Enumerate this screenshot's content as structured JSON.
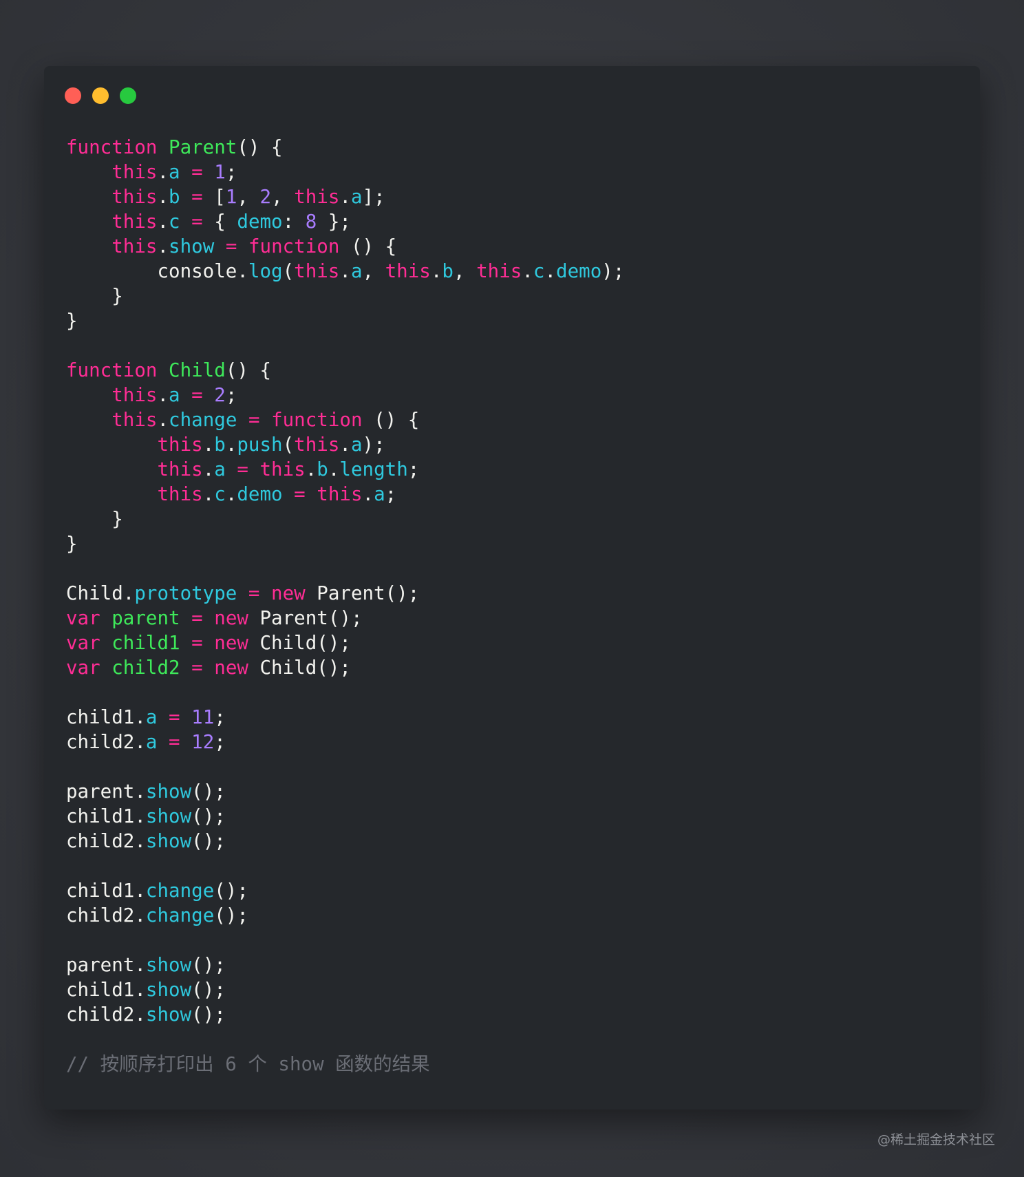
{
  "window": {
    "controls": [
      {
        "name": "close",
        "color": "#ff5f56"
      },
      {
        "name": "minimize",
        "color": "#ffbd2e"
      },
      {
        "name": "maximize",
        "color": "#27c93f"
      }
    ]
  },
  "code": {
    "language": "javascript",
    "lines": [
      [
        {
          "t": "k",
          "v": "function"
        },
        {
          "t": "t",
          "v": " "
        },
        {
          "t": "f",
          "v": "Parent"
        },
        {
          "t": "t",
          "v": "() {"
        }
      ],
      [
        {
          "t": "t",
          "v": "    "
        },
        {
          "t": "k",
          "v": "this"
        },
        {
          "t": "t",
          "v": "."
        },
        {
          "t": "p",
          "v": "a"
        },
        {
          "t": "t",
          "v": " "
        },
        {
          "t": "k",
          "v": "="
        },
        {
          "t": "t",
          "v": " "
        },
        {
          "t": "n",
          "v": "1"
        },
        {
          "t": "t",
          "v": ";"
        }
      ],
      [
        {
          "t": "t",
          "v": "    "
        },
        {
          "t": "k",
          "v": "this"
        },
        {
          "t": "t",
          "v": "."
        },
        {
          "t": "p",
          "v": "b"
        },
        {
          "t": "t",
          "v": " "
        },
        {
          "t": "k",
          "v": "="
        },
        {
          "t": "t",
          "v": " ["
        },
        {
          "t": "n",
          "v": "1"
        },
        {
          "t": "t",
          "v": ", "
        },
        {
          "t": "n",
          "v": "2"
        },
        {
          "t": "t",
          "v": ", "
        },
        {
          "t": "k",
          "v": "this"
        },
        {
          "t": "t",
          "v": "."
        },
        {
          "t": "p",
          "v": "a"
        },
        {
          "t": "t",
          "v": "];"
        }
      ],
      [
        {
          "t": "t",
          "v": "    "
        },
        {
          "t": "k",
          "v": "this"
        },
        {
          "t": "t",
          "v": "."
        },
        {
          "t": "p",
          "v": "c"
        },
        {
          "t": "t",
          "v": " "
        },
        {
          "t": "k",
          "v": "="
        },
        {
          "t": "t",
          "v": " { "
        },
        {
          "t": "p",
          "v": "demo"
        },
        {
          "t": "t",
          "v": ": "
        },
        {
          "t": "n",
          "v": "8"
        },
        {
          "t": "t",
          "v": " };"
        }
      ],
      [
        {
          "t": "t",
          "v": "    "
        },
        {
          "t": "k",
          "v": "this"
        },
        {
          "t": "t",
          "v": "."
        },
        {
          "t": "p",
          "v": "show"
        },
        {
          "t": "t",
          "v": " "
        },
        {
          "t": "k",
          "v": "="
        },
        {
          "t": "t",
          "v": " "
        },
        {
          "t": "k",
          "v": "function"
        },
        {
          "t": "t",
          "v": " () {"
        }
      ],
      [
        {
          "t": "t",
          "v": "        console."
        },
        {
          "t": "p",
          "v": "log"
        },
        {
          "t": "t",
          "v": "("
        },
        {
          "t": "k",
          "v": "this"
        },
        {
          "t": "t",
          "v": "."
        },
        {
          "t": "p",
          "v": "a"
        },
        {
          "t": "t",
          "v": ", "
        },
        {
          "t": "k",
          "v": "this"
        },
        {
          "t": "t",
          "v": "."
        },
        {
          "t": "p",
          "v": "b"
        },
        {
          "t": "t",
          "v": ", "
        },
        {
          "t": "k",
          "v": "this"
        },
        {
          "t": "t",
          "v": "."
        },
        {
          "t": "p",
          "v": "c"
        },
        {
          "t": "t",
          "v": "."
        },
        {
          "t": "p",
          "v": "demo"
        },
        {
          "t": "t",
          "v": ");"
        }
      ],
      [
        {
          "t": "t",
          "v": "    }"
        }
      ],
      [
        {
          "t": "t",
          "v": "}"
        }
      ],
      [],
      [
        {
          "t": "k",
          "v": "function"
        },
        {
          "t": "t",
          "v": " "
        },
        {
          "t": "f",
          "v": "Child"
        },
        {
          "t": "t",
          "v": "() {"
        }
      ],
      [
        {
          "t": "t",
          "v": "    "
        },
        {
          "t": "k",
          "v": "this"
        },
        {
          "t": "t",
          "v": "."
        },
        {
          "t": "p",
          "v": "a"
        },
        {
          "t": "t",
          "v": " "
        },
        {
          "t": "k",
          "v": "="
        },
        {
          "t": "t",
          "v": " "
        },
        {
          "t": "n",
          "v": "2"
        },
        {
          "t": "t",
          "v": ";"
        }
      ],
      [
        {
          "t": "t",
          "v": "    "
        },
        {
          "t": "k",
          "v": "this"
        },
        {
          "t": "t",
          "v": "."
        },
        {
          "t": "p",
          "v": "change"
        },
        {
          "t": "t",
          "v": " "
        },
        {
          "t": "k",
          "v": "="
        },
        {
          "t": "t",
          "v": " "
        },
        {
          "t": "k",
          "v": "function"
        },
        {
          "t": "t",
          "v": " () {"
        }
      ],
      [
        {
          "t": "t",
          "v": "        "
        },
        {
          "t": "k",
          "v": "this"
        },
        {
          "t": "t",
          "v": "."
        },
        {
          "t": "p",
          "v": "b"
        },
        {
          "t": "t",
          "v": "."
        },
        {
          "t": "p",
          "v": "push"
        },
        {
          "t": "t",
          "v": "("
        },
        {
          "t": "k",
          "v": "this"
        },
        {
          "t": "t",
          "v": "."
        },
        {
          "t": "p",
          "v": "a"
        },
        {
          "t": "t",
          "v": ");"
        }
      ],
      [
        {
          "t": "t",
          "v": "        "
        },
        {
          "t": "k",
          "v": "this"
        },
        {
          "t": "t",
          "v": "."
        },
        {
          "t": "p",
          "v": "a"
        },
        {
          "t": "t",
          "v": " "
        },
        {
          "t": "k",
          "v": "="
        },
        {
          "t": "t",
          "v": " "
        },
        {
          "t": "k",
          "v": "this"
        },
        {
          "t": "t",
          "v": "."
        },
        {
          "t": "p",
          "v": "b"
        },
        {
          "t": "t",
          "v": "."
        },
        {
          "t": "p",
          "v": "length"
        },
        {
          "t": "t",
          "v": ";"
        }
      ],
      [
        {
          "t": "t",
          "v": "        "
        },
        {
          "t": "k",
          "v": "this"
        },
        {
          "t": "t",
          "v": "."
        },
        {
          "t": "p",
          "v": "c"
        },
        {
          "t": "t",
          "v": "."
        },
        {
          "t": "p",
          "v": "demo"
        },
        {
          "t": "t",
          "v": " "
        },
        {
          "t": "k",
          "v": "="
        },
        {
          "t": "t",
          "v": " "
        },
        {
          "t": "k",
          "v": "this"
        },
        {
          "t": "t",
          "v": "."
        },
        {
          "t": "p",
          "v": "a"
        },
        {
          "t": "t",
          "v": ";"
        }
      ],
      [
        {
          "t": "t",
          "v": "    }"
        }
      ],
      [
        {
          "t": "t",
          "v": "}"
        }
      ],
      [],
      [
        {
          "t": "t",
          "v": "Child."
        },
        {
          "t": "p",
          "v": "prototype"
        },
        {
          "t": "t",
          "v": " "
        },
        {
          "t": "k",
          "v": "="
        },
        {
          "t": "t",
          "v": " "
        },
        {
          "t": "k",
          "v": "new"
        },
        {
          "t": "t",
          "v": " Parent();"
        }
      ],
      [
        {
          "t": "k",
          "v": "var"
        },
        {
          "t": "t",
          "v": " "
        },
        {
          "t": "i",
          "v": "parent"
        },
        {
          "t": "t",
          "v": " "
        },
        {
          "t": "k",
          "v": "="
        },
        {
          "t": "t",
          "v": " "
        },
        {
          "t": "k",
          "v": "new"
        },
        {
          "t": "t",
          "v": " Parent();"
        }
      ],
      [
        {
          "t": "k",
          "v": "var"
        },
        {
          "t": "t",
          "v": " "
        },
        {
          "t": "i",
          "v": "child1"
        },
        {
          "t": "t",
          "v": " "
        },
        {
          "t": "k",
          "v": "="
        },
        {
          "t": "t",
          "v": " "
        },
        {
          "t": "k",
          "v": "new"
        },
        {
          "t": "t",
          "v": " Child();"
        }
      ],
      [
        {
          "t": "k",
          "v": "var"
        },
        {
          "t": "t",
          "v": " "
        },
        {
          "t": "i",
          "v": "child2"
        },
        {
          "t": "t",
          "v": " "
        },
        {
          "t": "k",
          "v": "="
        },
        {
          "t": "t",
          "v": " "
        },
        {
          "t": "k",
          "v": "new"
        },
        {
          "t": "t",
          "v": " Child();"
        }
      ],
      [],
      [
        {
          "t": "t",
          "v": "child1."
        },
        {
          "t": "p",
          "v": "a"
        },
        {
          "t": "t",
          "v": " "
        },
        {
          "t": "k",
          "v": "="
        },
        {
          "t": "t",
          "v": " "
        },
        {
          "t": "n",
          "v": "11"
        },
        {
          "t": "t",
          "v": ";"
        }
      ],
      [
        {
          "t": "t",
          "v": "child2."
        },
        {
          "t": "p",
          "v": "a"
        },
        {
          "t": "t",
          "v": " "
        },
        {
          "t": "k",
          "v": "="
        },
        {
          "t": "t",
          "v": " "
        },
        {
          "t": "n",
          "v": "12"
        },
        {
          "t": "t",
          "v": ";"
        }
      ],
      [],
      [
        {
          "t": "t",
          "v": "parent."
        },
        {
          "t": "p",
          "v": "show"
        },
        {
          "t": "t",
          "v": "();"
        }
      ],
      [
        {
          "t": "t",
          "v": "child1."
        },
        {
          "t": "p",
          "v": "show"
        },
        {
          "t": "t",
          "v": "();"
        }
      ],
      [
        {
          "t": "t",
          "v": "child2."
        },
        {
          "t": "p",
          "v": "show"
        },
        {
          "t": "t",
          "v": "();"
        }
      ],
      [],
      [
        {
          "t": "t",
          "v": "child1."
        },
        {
          "t": "p",
          "v": "change"
        },
        {
          "t": "t",
          "v": "();"
        }
      ],
      [
        {
          "t": "t",
          "v": "child2."
        },
        {
          "t": "p",
          "v": "change"
        },
        {
          "t": "t",
          "v": "();"
        }
      ],
      [],
      [
        {
          "t": "t",
          "v": "parent."
        },
        {
          "t": "p",
          "v": "show"
        },
        {
          "t": "t",
          "v": "();"
        }
      ],
      [
        {
          "t": "t",
          "v": "child1."
        },
        {
          "t": "p",
          "v": "show"
        },
        {
          "t": "t",
          "v": "();"
        }
      ],
      [
        {
          "t": "t",
          "v": "child2."
        },
        {
          "t": "p",
          "v": "show"
        },
        {
          "t": "t",
          "v": "();"
        }
      ],
      [],
      [
        {
          "t": "c",
          "v": "// 按顺序打印出 6 个 show 函数的结果"
        }
      ]
    ]
  },
  "watermark": "@稀土掘金技术社区"
}
